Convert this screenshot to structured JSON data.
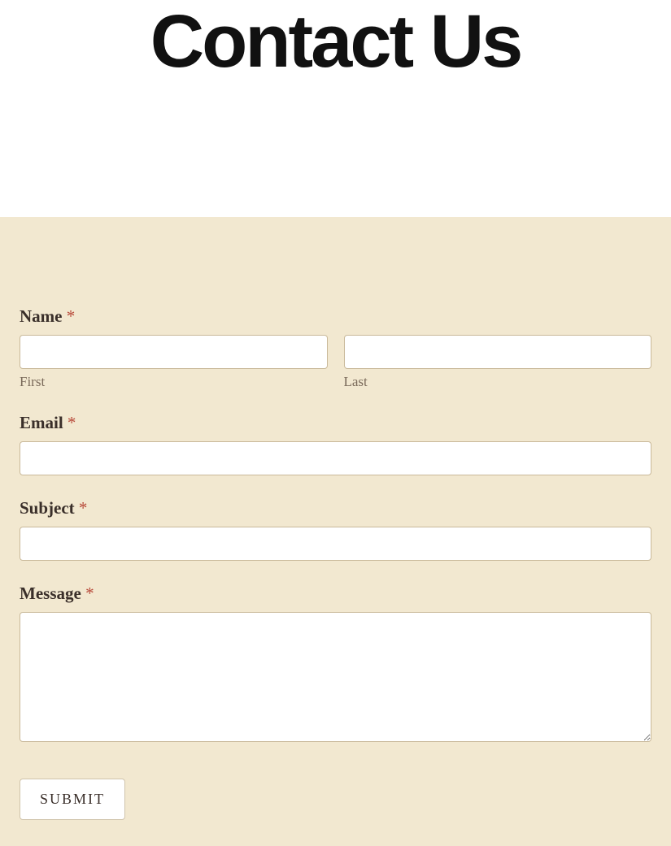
{
  "header": {
    "title": "Contact Us"
  },
  "form": {
    "name": {
      "label": "Name",
      "required_mark": "*",
      "first_sublabel": "First",
      "last_sublabel": "Last",
      "first_value": "",
      "last_value": ""
    },
    "email": {
      "label": "Email",
      "required_mark": "*",
      "value": ""
    },
    "subject": {
      "label": "Subject",
      "required_mark": "*",
      "value": ""
    },
    "message": {
      "label": "Message",
      "required_mark": "*",
      "value": ""
    },
    "submit_label": "SUBMIT"
  }
}
